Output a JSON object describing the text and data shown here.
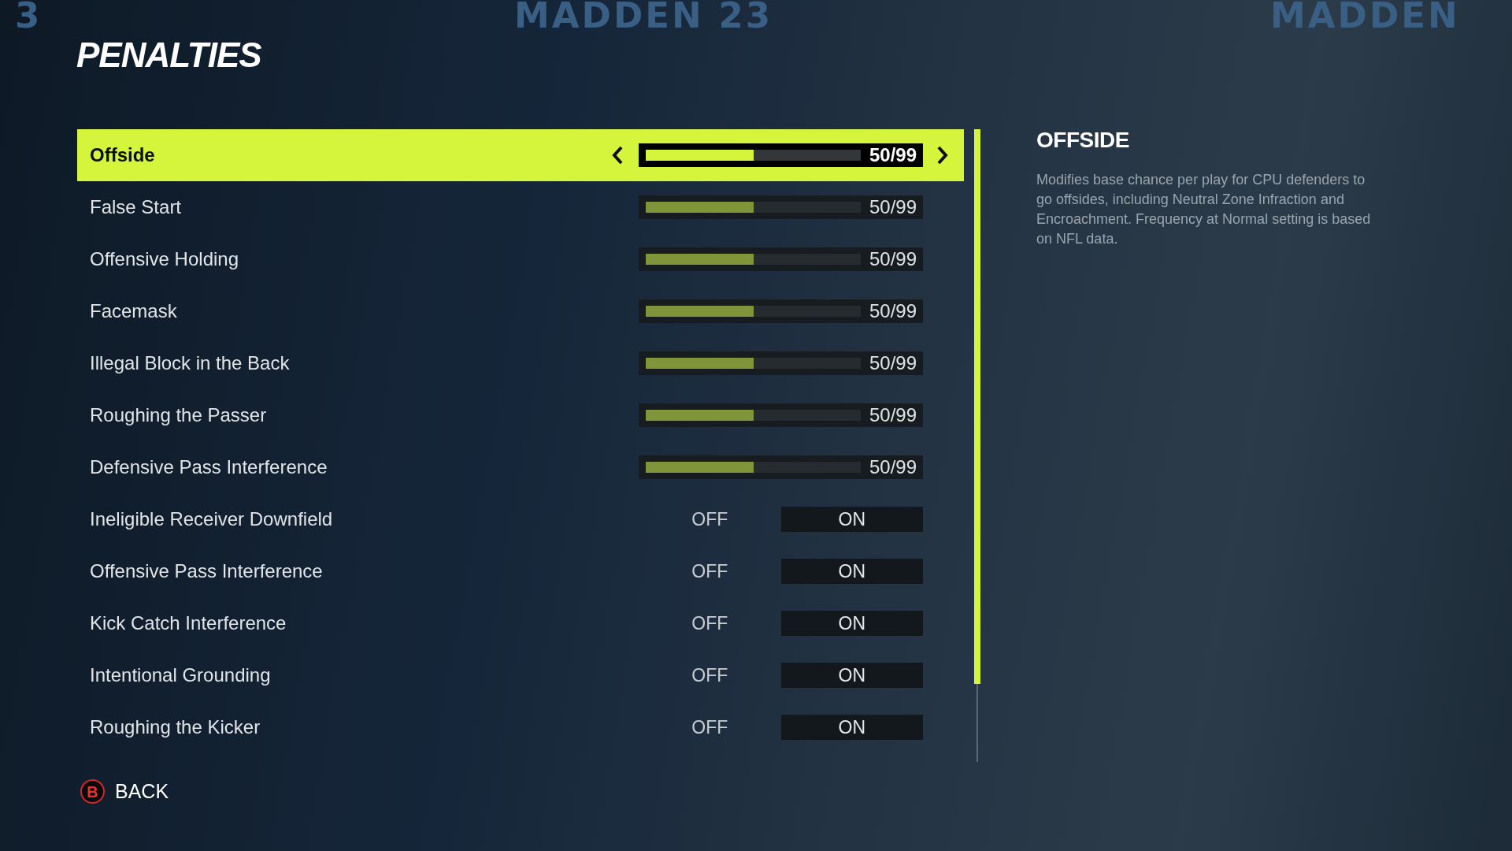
{
  "background_banner": [
    "3",
    "MADDEN 23",
    "MADDEN"
  ],
  "title": "PENALTIES",
  "settings": [
    {
      "kind": "slider",
      "label": "Offside",
      "selected": true,
      "level": 0.5,
      "reading": "50/99"
    },
    {
      "kind": "slider",
      "label": "False Start",
      "selected": false,
      "level": 0.5,
      "reading": "50/99"
    },
    {
      "kind": "slider",
      "label": "Offensive Holding",
      "selected": false,
      "level": 0.5,
      "reading": "50/99"
    },
    {
      "kind": "slider",
      "label": "Facemask",
      "selected": false,
      "level": 0.5,
      "reading": "50/99"
    },
    {
      "kind": "slider",
      "label": "Illegal Block in the Back",
      "selected": false,
      "level": 0.5,
      "reading": "50/99"
    },
    {
      "kind": "slider",
      "label": "Roughing the Passer",
      "selected": false,
      "level": 0.5,
      "reading": "50/99"
    },
    {
      "kind": "slider",
      "label": "Defensive Pass Interference",
      "selected": false,
      "level": 0.5,
      "reading": "50/99"
    },
    {
      "kind": "toggle",
      "label": "Ineligible Receiver Downfield",
      "selected": false,
      "options": [
        {
          "label": "OFF",
          "selected": false
        },
        {
          "label": "ON",
          "selected": true
        }
      ]
    },
    {
      "kind": "toggle",
      "label": "Offensive Pass Interference",
      "selected": false,
      "options": [
        {
          "label": "OFF",
          "selected": false
        },
        {
          "label": "ON",
          "selected": true
        }
      ]
    },
    {
      "kind": "toggle",
      "label": "Kick Catch Interference",
      "selected": false,
      "options": [
        {
          "label": "OFF",
          "selected": false
        },
        {
          "label": "ON",
          "selected": true
        }
      ]
    },
    {
      "kind": "toggle",
      "label": "Intentional Grounding",
      "selected": false,
      "options": [
        {
          "label": "OFF",
          "selected": false
        },
        {
          "label": "ON",
          "selected": true
        }
      ]
    },
    {
      "kind": "toggle",
      "label": "Roughing the Kicker",
      "selected": false,
      "options": [
        {
          "label": "OFF",
          "selected": false
        },
        {
          "label": "ON",
          "selected": true
        }
      ]
    }
  ],
  "description": {
    "title": "OFFSIDE",
    "text": "Modifies base chance per play for CPU defenders to go offsides, including Neutral Zone Infraction and Encroachment. Frequency at Normal setting is based on NFL data."
  },
  "back": {
    "glyph": "B",
    "label": "BACK"
  }
}
